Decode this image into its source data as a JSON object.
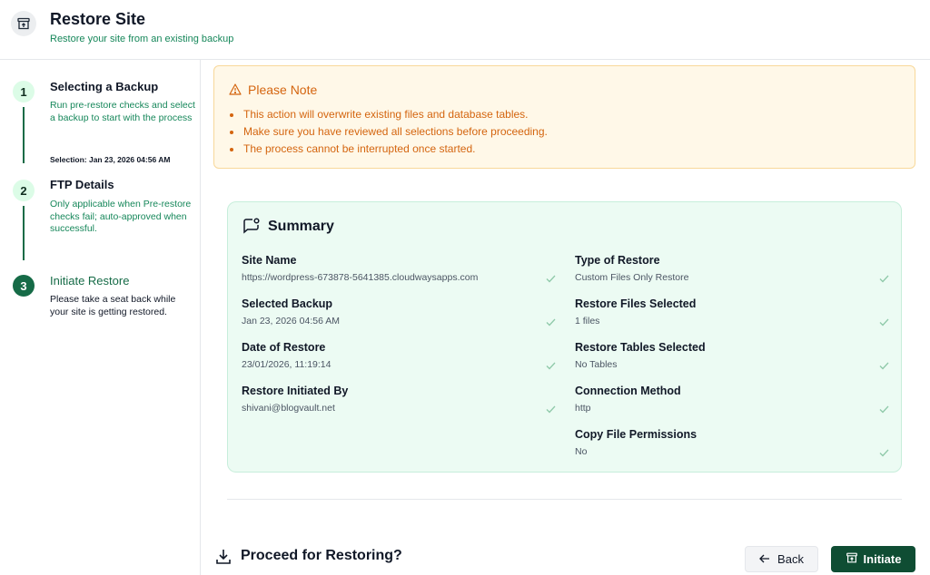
{
  "header": {
    "title": "Restore Site",
    "subtitle": "Restore your site from an existing backup",
    "icon": "archive-restore-icon"
  },
  "steps": [
    {
      "number": "1",
      "title": "Selecting a Backup",
      "description": "Run pre-restore checks and select a backup to start with the process",
      "selection": "Selection: Jan 23, 2026 04:56 AM",
      "status": "completed"
    },
    {
      "number": "2",
      "title": "FTP Details",
      "description": "Only applicable when Pre-restore checks fail; auto-approved when successful.",
      "status": "completed"
    },
    {
      "number": "3",
      "title": "Initiate Restore",
      "description": "Please take a seat back while your site is getting restored.",
      "status": "active"
    }
  ],
  "note": {
    "title": "Please Note",
    "icon": "warning-triangle-icon",
    "items": [
      "This action will overwrite existing files and database tables.",
      "Make sure you have reviewed all selections before proceeding.",
      "The process cannot be interrupted once started."
    ]
  },
  "summary": {
    "title": "Summary",
    "icon": "chat-bubble-icon",
    "left": [
      {
        "label": "Site Name",
        "value": "https://wordpress-673878-5641385.cloudwaysapps.com"
      },
      {
        "label": "Selected Backup",
        "value": "Jan 23, 2026 04:56 AM"
      },
      {
        "label": "Date of Restore",
        "value": "23/01/2026, 11:19:14"
      },
      {
        "label": "Restore Initiated By",
        "value": "shivani@blogvault.net"
      }
    ],
    "right": [
      {
        "label": "Type of Restore",
        "value": "Custom Files Only Restore"
      },
      {
        "label": "Restore Files Selected",
        "value": "1 files"
      },
      {
        "label": "Restore Tables Selected",
        "value": "No Tables"
      },
      {
        "label": "Connection Method",
        "value": "http"
      },
      {
        "label": "Copy File Permissions",
        "value": "No"
      }
    ]
  },
  "footer": {
    "proceed_text": "Proceed for Restoring?",
    "back_label": "Back",
    "initiate_label": "Initiate"
  },
  "colors": {
    "brand_green": "#166b47",
    "button_dark_green": "#0f4d33",
    "accent_text_green": "#16875a",
    "warning_orange": "#d4650f",
    "warning_bg": "#fff8e8",
    "summary_bg": "#ecfbf3"
  }
}
